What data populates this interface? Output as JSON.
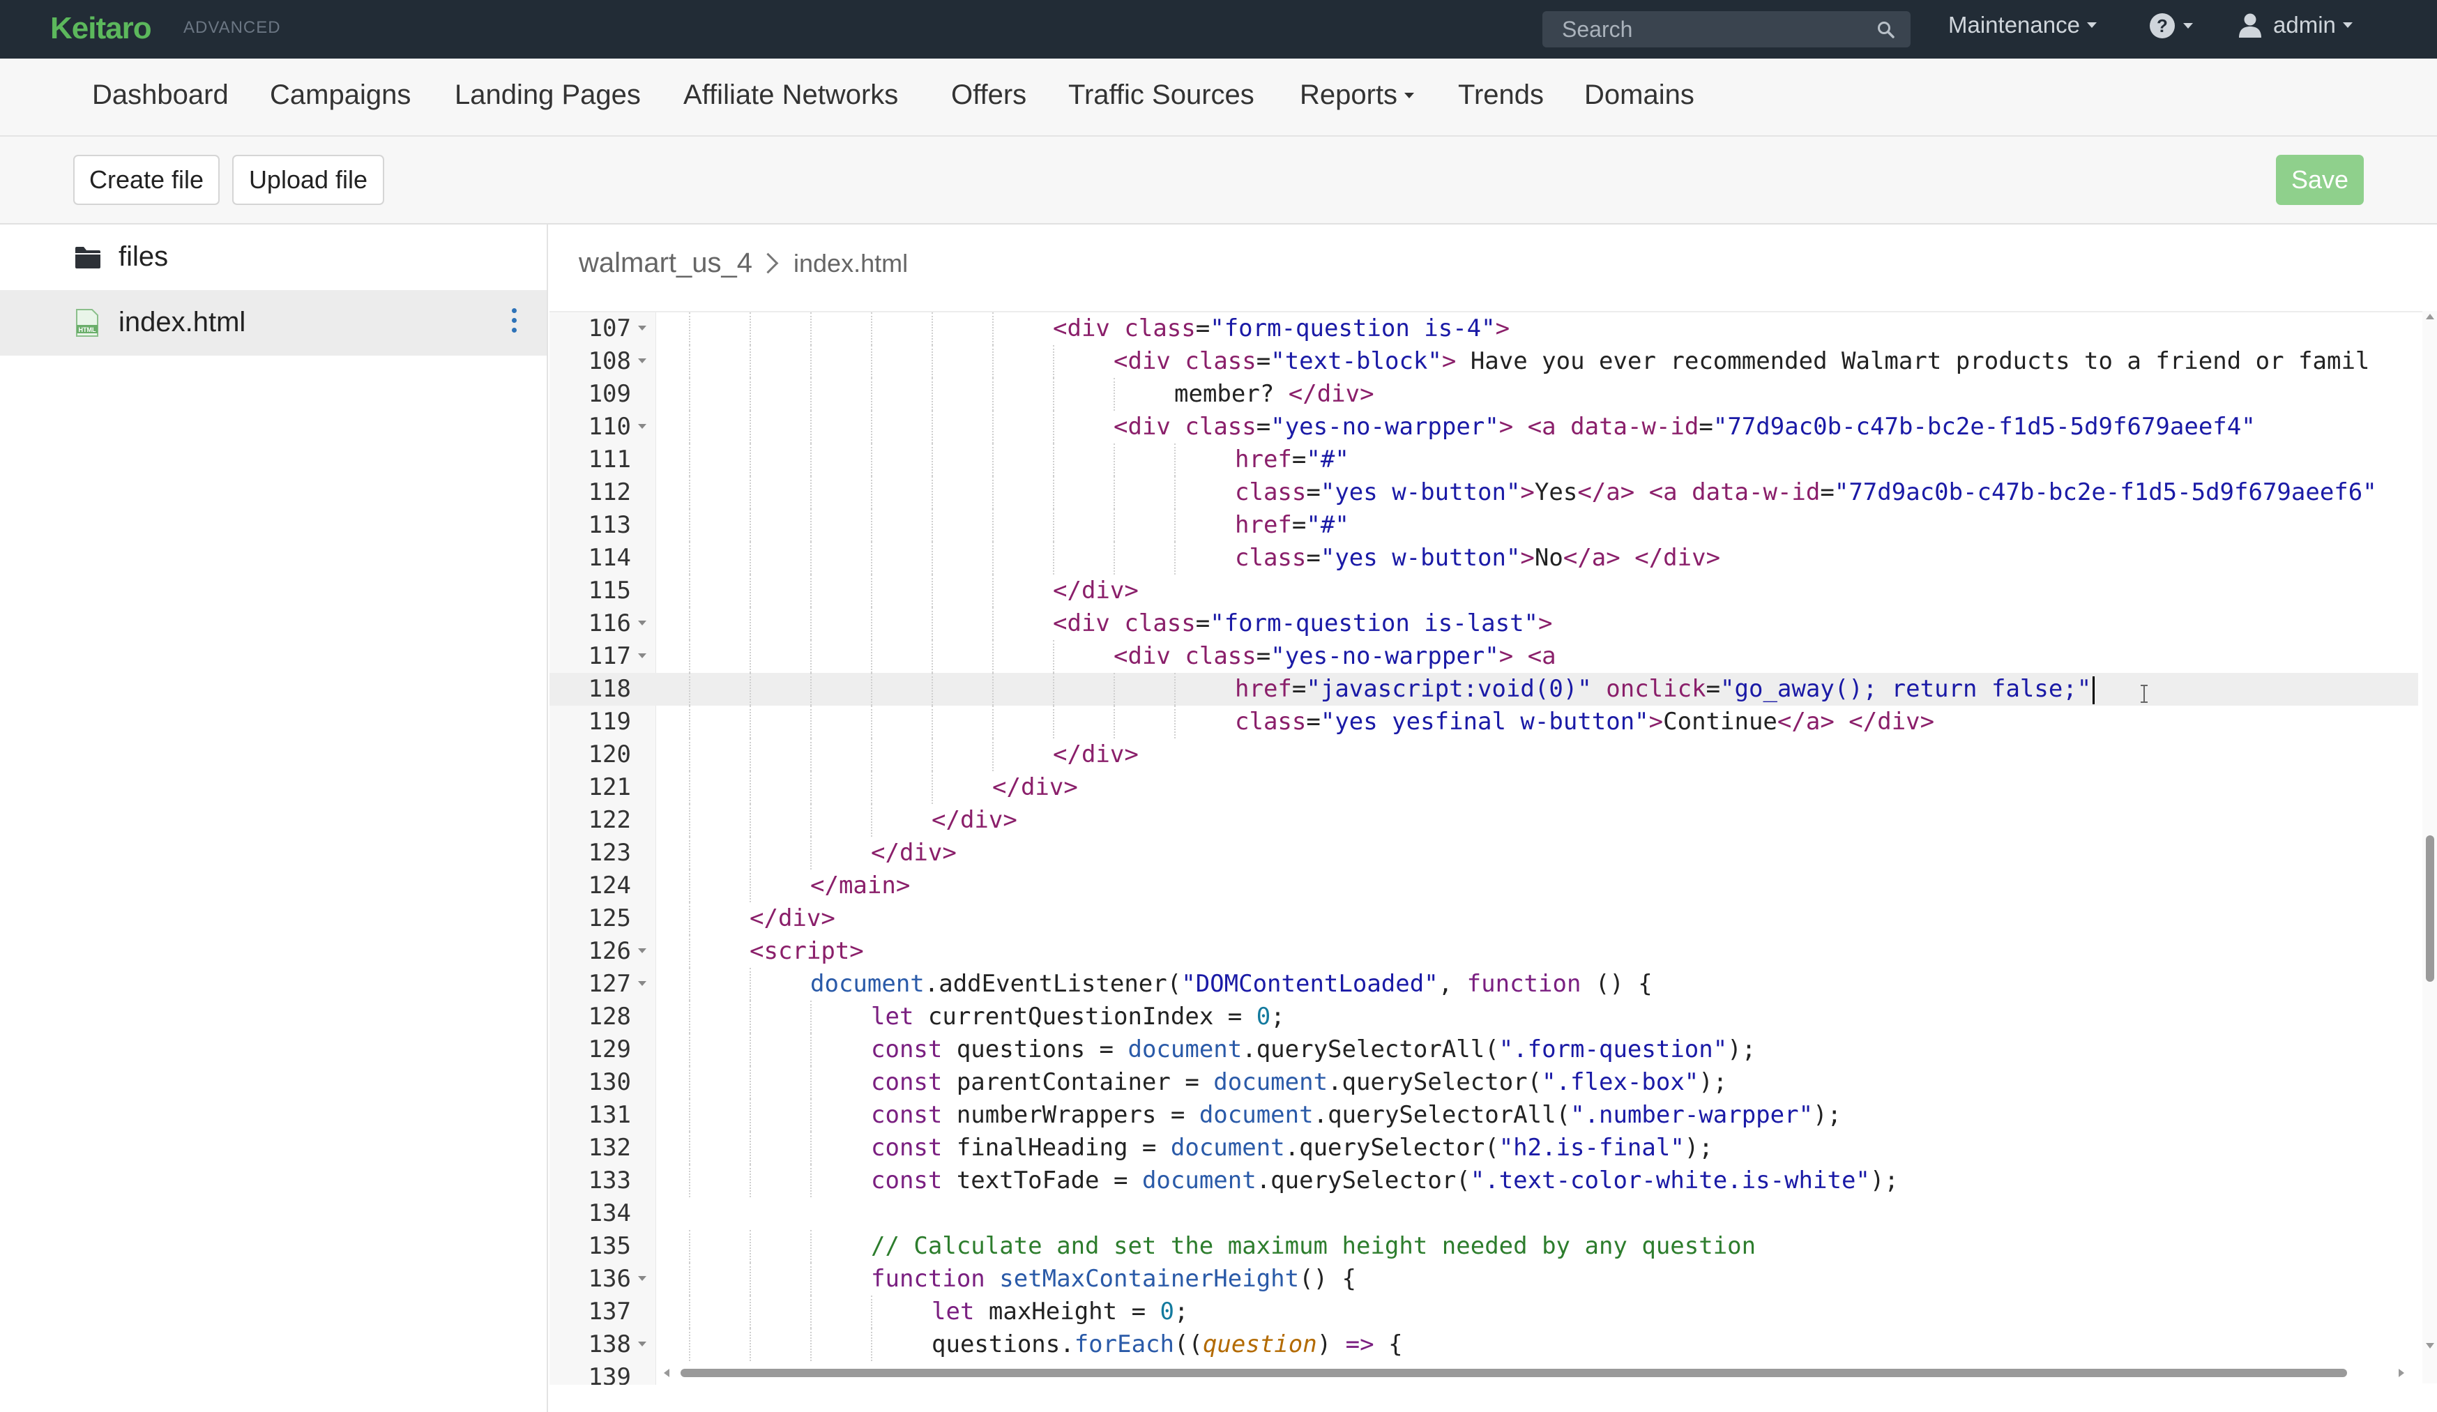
{
  "topbar": {
    "logo": "Keitaro",
    "edition": "ADVANCED",
    "search_placeholder": "Search",
    "maintenance": "Maintenance",
    "user": "admin"
  },
  "nav": [
    "Dashboard",
    "Campaigns",
    "Landing Pages",
    "Affiliate Networks",
    "Offers",
    "Traffic Sources",
    "Reports",
    "Trends",
    "Domains"
  ],
  "toolbar": {
    "create": "Create file",
    "upload": "Upload file",
    "save": "Save"
  },
  "sidebar": {
    "folder": "files",
    "file": "index.html"
  },
  "breadcrumb": {
    "folder": "walmart_us_4",
    "file": "index.html"
  },
  "editor": {
    "active_line": 118,
    "lines": [
      {
        "n": "107",
        "f": true,
        "i": 6,
        "html": "<span class='t'>&lt;div</span> <span class='a'>class</span>=<span class='s'>\"form-question is-4\"</span><span class='t'>&gt;</span>"
      },
      {
        "n": "108",
        "f": true,
        "i": 7,
        "html": "<span class='t'>&lt;div</span> <span class='a'>class</span>=<span class='s'>\"text-block\"</span><span class='t'>&gt;</span> Have you ever recommended Walmart products to a friend or famil"
      },
      {
        "n": "109",
        "f": false,
        "i": 8,
        "html": "member? <span class='t'>&lt;/div&gt;</span>"
      },
      {
        "n": "110",
        "f": true,
        "i": 7,
        "html": "<span class='t'>&lt;div</span> <span class='a'>class</span>=<span class='s'>\"yes-no-warpper\"</span><span class='t'>&gt;</span> <span class='t'>&lt;a</span> <span class='a'>data-w-id</span>=<span class='s'>\"77d9ac0b-c47b-bc2e-f1d5-5d9f679aeef4\"</span>"
      },
      {
        "n": "111",
        "f": false,
        "i": 9,
        "html": "<span class='a'>href</span>=<span class='s'>\"#\"</span>"
      },
      {
        "n": "112",
        "f": false,
        "i": 9,
        "html": "<span class='a'>class</span>=<span class='s'>\"yes w-button\"</span><span class='t'>&gt;</span>Yes<span class='t'>&lt;/a&gt;</span> <span class='t'>&lt;a</span> <span class='a'>data-w-id</span>=<span class='s'>\"77d9ac0b-c47b-bc2e-f1d5-5d9f679aeef6\"</span>"
      },
      {
        "n": "113",
        "f": false,
        "i": 9,
        "html": "<span class='a'>href</span>=<span class='s'>\"#\"</span>"
      },
      {
        "n": "114",
        "f": false,
        "i": 9,
        "html": "<span class='a'>class</span>=<span class='s'>\"yes w-button\"</span><span class='t'>&gt;</span>No<span class='t'>&lt;/a&gt;</span> <span class='t'>&lt;/div&gt;</span>"
      },
      {
        "n": "115",
        "f": false,
        "i": 6,
        "html": "<span class='t'>&lt;/div&gt;</span>"
      },
      {
        "n": "116",
        "f": true,
        "i": 6,
        "html": "<span class='t'>&lt;div</span> <span class='a'>class</span>=<span class='s'>\"form-question is-last\"</span><span class='t'>&gt;</span>"
      },
      {
        "n": "117",
        "f": true,
        "i": 7,
        "html": "<span class='t'>&lt;div</span> <span class='a'>class</span>=<span class='s'>\"yes-no-warpper\"</span><span class='t'>&gt;</span> <span class='t'>&lt;a</span>"
      },
      {
        "n": "118",
        "f": false,
        "i": 9,
        "html": "<span class='a'>href</span>=<span class='s'>\"javascript:void(0)\"</span> <span class='a'>onclick</span>=<span class='s'>\"go_away(); return false;\"</span><span class='cursor'></span>"
      },
      {
        "n": "119",
        "f": false,
        "i": 9,
        "html": "<span class='a'>class</span>=<span class='s'>\"yes yesfinal w-button\"</span><span class='t'>&gt;</span>Continue<span class='t'>&lt;/a&gt;</span> <span class='t'>&lt;/div&gt;</span>"
      },
      {
        "n": "120",
        "f": false,
        "i": 6,
        "html": "<span class='t'>&lt;/div&gt;</span>"
      },
      {
        "n": "121",
        "f": false,
        "i": 5,
        "html": "<span class='t'>&lt;/div&gt;</span>"
      },
      {
        "n": "122",
        "f": false,
        "i": 4,
        "html": "<span class='t'>&lt;/div&gt;</span>"
      },
      {
        "n": "123",
        "f": false,
        "i": 3,
        "html": "<span class='t'>&lt;/div&gt;</span>"
      },
      {
        "n": "124",
        "f": false,
        "i": 2,
        "html": "<span class='t'>&lt;/main&gt;</span>"
      },
      {
        "n": "125",
        "f": false,
        "i": 1,
        "html": "<span class='t'>&lt;/div&gt;</span>"
      },
      {
        "n": "126",
        "f": true,
        "i": 1,
        "html": "<span class='t'>&lt;script&gt;</span>"
      },
      {
        "n": "127",
        "f": true,
        "i": 2,
        "html": "<span class='v'>document</span>.addEventListener(<span class='s'>\"DOMContentLoaded\"</span>, <span class='k'>function</span> () {"
      },
      {
        "n": "128",
        "f": false,
        "i": 3,
        "html": "<span class='k'>let</span> currentQuestionIndex = <span class='n'>0</span>;"
      },
      {
        "n": "129",
        "f": false,
        "i": 3,
        "html": "<span class='k'>const</span> questions = <span class='v'>document</span>.querySelectorAll(<span class='s'>\".form-question\"</span>);"
      },
      {
        "n": "130",
        "f": false,
        "i": 3,
        "html": "<span class='k'>const</span> parentContainer = <span class='v'>document</span>.querySelector(<span class='s'>\".flex-box\"</span>);"
      },
      {
        "n": "131",
        "f": false,
        "i": 3,
        "html": "<span class='k'>const</span> numberWrappers = <span class='v'>document</span>.querySelectorAll(<span class='s'>\".number-warpper\"</span>);"
      },
      {
        "n": "132",
        "f": false,
        "i": 3,
        "html": "<span class='k'>const</span> finalHeading = <span class='v'>document</span>.querySelector(<span class='s'>\"h2.is-final\"</span>);"
      },
      {
        "n": "133",
        "f": false,
        "i": 3,
        "html": "<span class='k'>const</span> textToFade = <span class='v'>document</span>.querySelector(<span class='s'>\".text-color-white.is-white\"</span>);"
      },
      {
        "n": "134",
        "f": false,
        "i": 0,
        "html": ""
      },
      {
        "n": "135",
        "f": false,
        "i": 3,
        "html": "<span class='c'>// Calculate and set the maximum height needed by any question</span>"
      },
      {
        "n": "136",
        "f": true,
        "i": 3,
        "html": "<span class='k'>function</span> <span class='v'>setMaxContainerHeight</span>() {"
      },
      {
        "n": "137",
        "f": false,
        "i": 4,
        "html": "<span class='k'>let</span> maxHeight = <span class='n'>0</span>;"
      },
      {
        "n": "138",
        "f": true,
        "i": 4,
        "html": "questions.<span class='v'>forEach</span>((<span class='p'>question</span>) <span class='k'>=&gt;</span> {"
      },
      {
        "n": "139",
        "f": false,
        "i": 0,
        "html": ""
      }
    ]
  }
}
